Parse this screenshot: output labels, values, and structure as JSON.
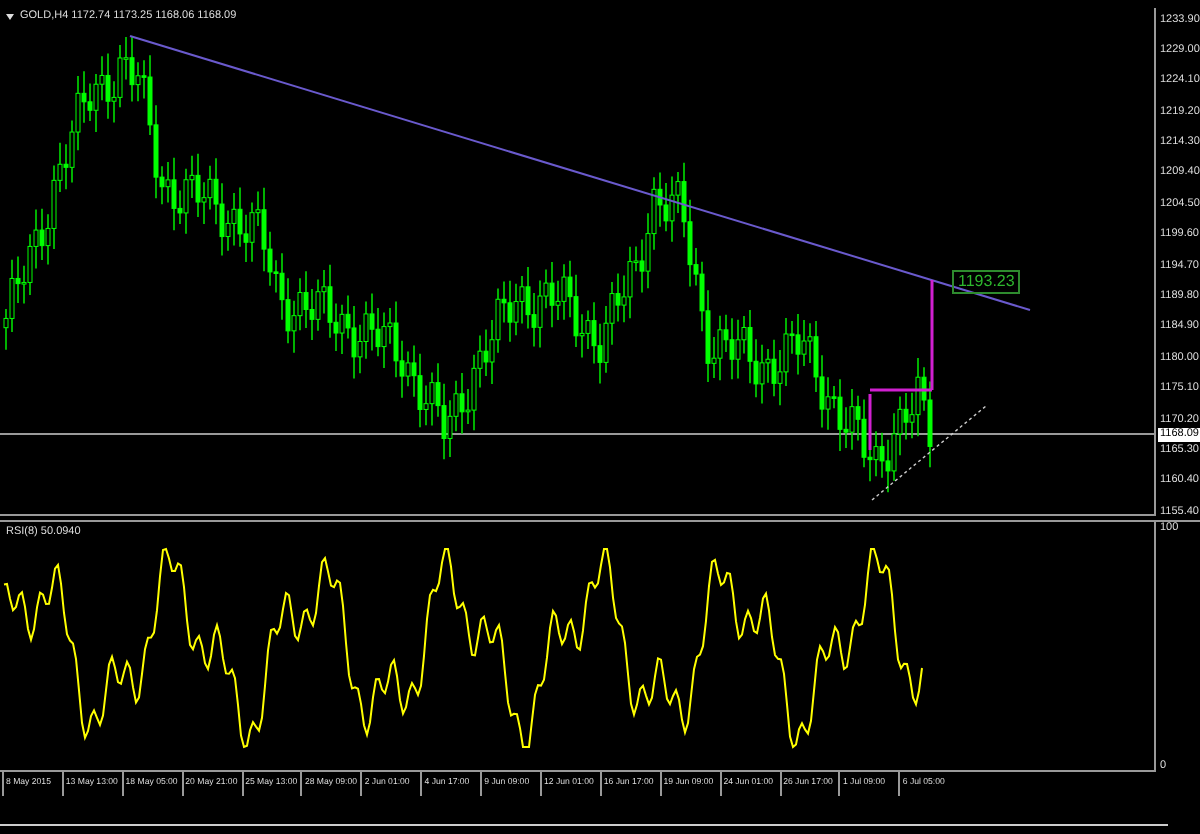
{
  "symbol_header": {
    "text": "GOLD,H4 1172.74 1173.25 1168.06 1168.09"
  },
  "price_axis": {
    "ticks": [
      "1233.90",
      "1229.00",
      "1224.10",
      "1219.20",
      "1214.30",
      "1209.40",
      "1204.50",
      "1199.60",
      "1194.70",
      "1189.80",
      "1184.90",
      "1180.00",
      "1175.10",
      "1170.20",
      "1165.30",
      "1160.40",
      "1155.40"
    ],
    "current_price": "1168.09"
  },
  "target_label": "1193.23",
  "rsi_panel": {
    "label": "RSI(8) 50.0940",
    "axis_ticks": [
      "100",
      "0"
    ]
  },
  "time_axis": {
    "ticks": [
      "8 May 2015",
      "13 May 13:00",
      "18 May 05:00",
      "20 May 21:00",
      "25 May 13:00",
      "28 May 09:00",
      "2 Jun 01:00",
      "4 Jun 17:00",
      "9 Jun 09:00",
      "12 Jun 01:00",
      "16 Jun 17:00",
      "19 Jun 09:00",
      "24 Jun 01:00",
      "26 Jun 17:00",
      "1 Jul 09:00",
      "6 Jul 05:00"
    ]
  }
}
